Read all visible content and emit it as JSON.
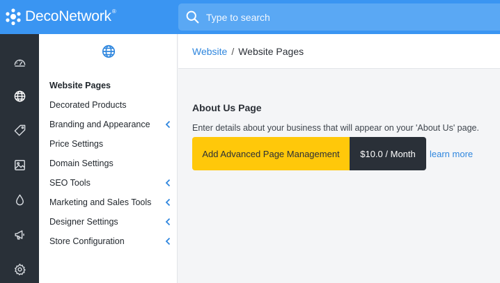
{
  "app": {
    "logo_text": "DecoNetwork",
    "logo_mark": "®"
  },
  "search": {
    "placeholder": "Type to search"
  },
  "rail": {
    "items": [
      {
        "icon": "dashboard-icon"
      },
      {
        "icon": "globe-icon",
        "active": true
      },
      {
        "icon": "tag-icon"
      },
      {
        "icon": "image-icon"
      },
      {
        "icon": "droplet-icon"
      },
      {
        "icon": "megaphone-icon"
      },
      {
        "icon": "gear-icon"
      }
    ]
  },
  "sidebar": {
    "header_icon": "globe-icon",
    "items": [
      {
        "label": "Website Pages",
        "active": true,
        "has_submenu": false
      },
      {
        "label": "Decorated Products",
        "has_submenu": false
      },
      {
        "label": "Branding and Appearance",
        "has_submenu": true
      },
      {
        "label": "Price Settings",
        "has_submenu": false
      },
      {
        "label": "Domain Settings",
        "has_submenu": false
      },
      {
        "label": "SEO Tools",
        "has_submenu": true
      },
      {
        "label": "Marketing and Sales Tools",
        "has_submenu": true
      },
      {
        "label": "Designer Settings",
        "has_submenu": true
      },
      {
        "label": "Store Configuration",
        "has_submenu": true
      }
    ]
  },
  "breadcrumb": {
    "parent": "Website",
    "separator": "/",
    "current": "Website Pages"
  },
  "content": {
    "title": "About Us Page",
    "description": "Enter details about your business that will appear on your 'About Us' page.",
    "addon_label": "Add Advanced Page Management",
    "price_label": "$10.0 / Month",
    "learn_more": "learn more"
  },
  "colors": {
    "topbar": "#3a95f2",
    "rail": "#293038",
    "accent_yellow": "#ffc80a",
    "link_blue": "#2e86de"
  }
}
